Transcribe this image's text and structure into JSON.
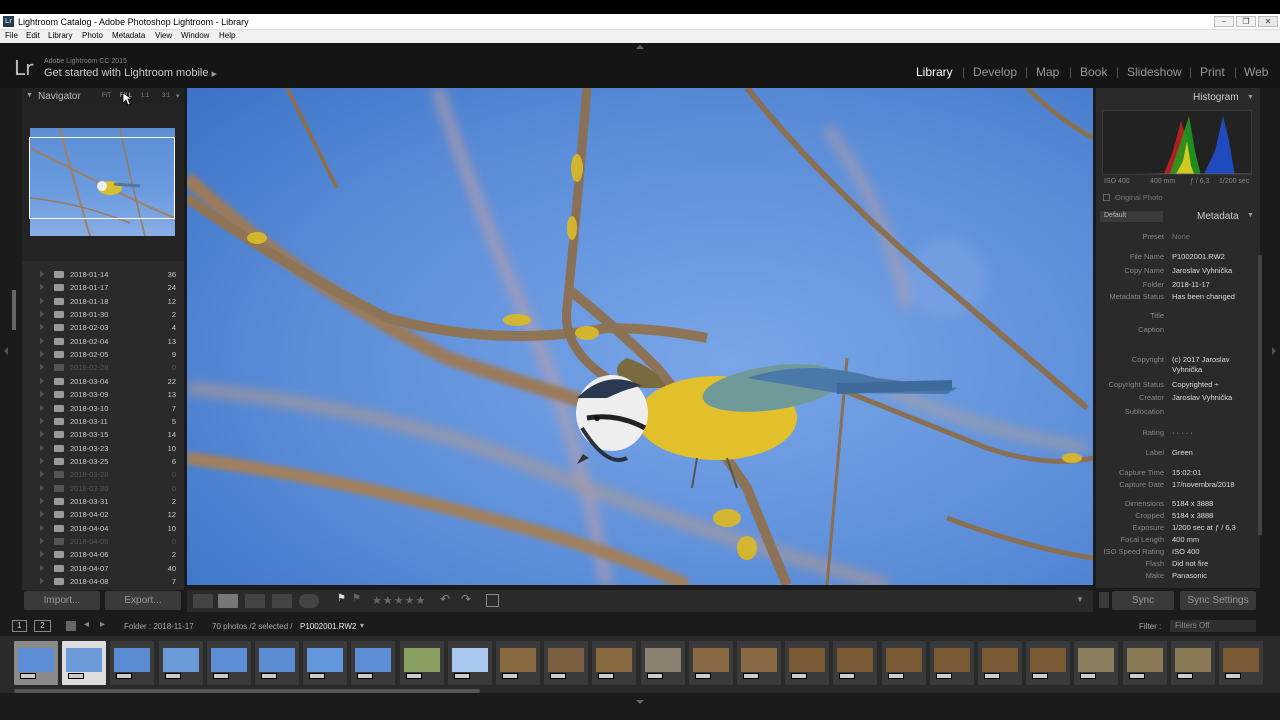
{
  "window": {
    "title": "Lightroom Catalog - Adobe Photoshop Lightroom - Library",
    "minimize": "–",
    "maximize": "❐",
    "close": "✕"
  },
  "menu": [
    "File",
    "Edit",
    "Library",
    "Photo",
    "Metadata",
    "View",
    "Window",
    "Help"
  ],
  "identity": {
    "logo": "Lr",
    "product": "Adobe Lightroom CC 2015",
    "tagline": "Get started with Lightroom mobile",
    "arrow": "▶"
  },
  "modules": [
    {
      "label": "Library",
      "active": true
    },
    {
      "label": "Develop",
      "active": false
    },
    {
      "label": "Map",
      "active": false
    },
    {
      "label": "Book",
      "active": false
    },
    {
      "label": "Slideshow",
      "active": false
    },
    {
      "label": "Print",
      "active": false
    },
    {
      "label": "Web",
      "active": false
    }
  ],
  "navigator": {
    "title": "Navigator",
    "zoom": [
      "FIT",
      "FILL",
      "1:1",
      "3:1"
    ],
    "zoom_arrow": "▾"
  },
  "folders": [
    {
      "name": "2018-01-14",
      "count": "36",
      "dim": false
    },
    {
      "name": "2018-01-17",
      "count": "24",
      "dim": false
    },
    {
      "name": "2018-01-18",
      "count": "12",
      "dim": false
    },
    {
      "name": "2018-01-30",
      "count": "2",
      "dim": false
    },
    {
      "name": "2018-02-03",
      "count": "4",
      "dim": false
    },
    {
      "name": "2018-02-04",
      "count": "13",
      "dim": false
    },
    {
      "name": "2018-02-05",
      "count": "9",
      "dim": false
    },
    {
      "name": "2018-02-28",
      "count": "0",
      "dim": true
    },
    {
      "name": "2018-03-04",
      "count": "22",
      "dim": false
    },
    {
      "name": "2018-03-09",
      "count": "13",
      "dim": false
    },
    {
      "name": "2018-03-10",
      "count": "7",
      "dim": false
    },
    {
      "name": "2018-03-11",
      "count": "5",
      "dim": false
    },
    {
      "name": "2018-03-15",
      "count": "14",
      "dim": false
    },
    {
      "name": "2018-03-23",
      "count": "10",
      "dim": false
    },
    {
      "name": "2018-03-25",
      "count": "6",
      "dim": false
    },
    {
      "name": "2018-03-28",
      "count": "0",
      "dim": true
    },
    {
      "name": "2018-03-30",
      "count": "0",
      "dim": true
    },
    {
      "name": "2018-03-31",
      "count": "2",
      "dim": false
    },
    {
      "name": "2018-04-02",
      "count": "12",
      "dim": false
    },
    {
      "name": "2018-04-04",
      "count": "10",
      "dim": false
    },
    {
      "name": "2018-04-05",
      "count": "0",
      "dim": true
    },
    {
      "name": "2018-04-06",
      "count": "2",
      "dim": false
    },
    {
      "name": "2018-04-07",
      "count": "40",
      "dim": false
    },
    {
      "name": "2018-04-08",
      "count": "7",
      "dim": false
    }
  ],
  "left_buttons": {
    "import": "Import...",
    "export": "Export..."
  },
  "histogram": {
    "title": "Histogram",
    "arrow": "▼",
    "iso": "ISO 400",
    "focal": "400 mm",
    "aperture": "ƒ / 6,3",
    "shutter": "1/200 sec",
    "original_photo": "Original Photo"
  },
  "metadata": {
    "title": "Metadata",
    "preset_select": "Default",
    "fields": [
      {
        "label": "Preset",
        "value": "None"
      },
      {
        "label": "File Name",
        "value": "P1002001.RW2"
      },
      {
        "label": "Copy Name",
        "value": "Jaroslav Vyhnička"
      },
      {
        "label": "Folder",
        "value": "2018-11-17"
      },
      {
        "label": "Metadata Status",
        "value": "Has been changed"
      },
      {
        "label": "Title",
        "value": ""
      },
      {
        "label": "Caption",
        "value": ""
      },
      {
        "label": "Copyright",
        "value": "(c) 2017 Jaroslav"
      },
      {
        "label": "",
        "value": "Vyhnička"
      },
      {
        "label": "Copyright Status",
        "value": "Copyrighted ÷"
      },
      {
        "label": "Creator",
        "value": "Jaroslav Vyhnička"
      },
      {
        "label": "Sublocation",
        "value": ""
      },
      {
        "label": "Rating",
        "value": "· · · · ·"
      },
      {
        "label": "Label",
        "value": "Green"
      },
      {
        "label": "Capture Time",
        "value": "15:02:01"
      },
      {
        "label": "Capture Date",
        "value": "17/novembra/2018"
      },
      {
        "label": "Dimensions",
        "value": "5184 x 3888"
      },
      {
        "label": "Cropped",
        "value": "5184 x 3888"
      },
      {
        "label": "Exposure",
        "value": "1/200 sec at ƒ / 6,3"
      },
      {
        "label": "Focal Length",
        "value": "400 mm"
      },
      {
        "label": "ISO Speed Rating",
        "value": "ISO 400"
      },
      {
        "label": "Flash",
        "value": "Did not fire"
      },
      {
        "label": "Make",
        "value": "Panasonic"
      }
    ]
  },
  "right_buttons": {
    "sync": "Sync",
    "sync_settings": "Sync Settings"
  },
  "toolbar": {
    "stars": "★★★★★"
  },
  "filmstrip_bar": {
    "screen1": "1",
    "screen2": "2",
    "source": "Folder : 2018-11-17",
    "summary": "70 photos /2 selected /",
    "selected_file": "P1002001.RW2",
    "dropdown": "▾",
    "filter_label": "Filter :",
    "filter_value": "Filters Off"
  },
  "colors": {
    "accent": "#ffffff",
    "panel": "#2a2a2a",
    "sky": "#5f8fd8",
    "lichen": "#d8b82a"
  }
}
